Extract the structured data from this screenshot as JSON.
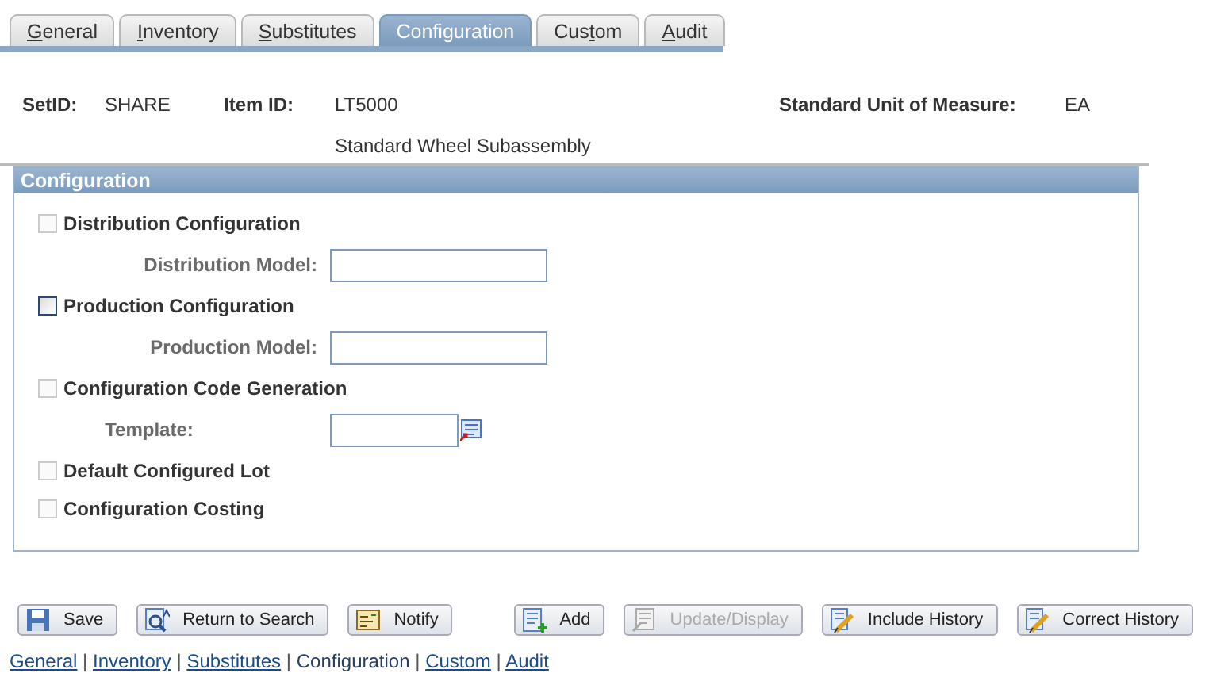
{
  "tabs": [
    {
      "key": "G",
      "post": "eneral",
      "selected": false
    },
    {
      "key": "I",
      "post": "nventory",
      "selected": false
    },
    {
      "key": "S",
      "post": "ubstitutes",
      "selected": false
    },
    {
      "pre": "Configuration",
      "selected": true
    },
    {
      "pre": "Cus",
      "key": "t",
      "post": "om",
      "selected": false
    },
    {
      "key": "A",
      "post": "udit",
      "selected": false
    }
  ],
  "header": {
    "setid_label": "SetID:",
    "setid": "SHARE",
    "item_label": "Item ID:",
    "item_id": "LT5000",
    "item_description": "Standard Wheel Subassembly",
    "uom_label": "Standard Unit of Measure:",
    "uom": "EA"
  },
  "section": {
    "title": "Configuration",
    "rows": [
      {
        "kind": "checkbox",
        "label": "Distribution Configuration",
        "checked": false,
        "disabled": true
      },
      {
        "kind": "field",
        "label": "Distribution Model:",
        "lookup": false
      },
      {
        "kind": "checkbox",
        "label": "Production Configuration",
        "checked": false,
        "disabled": false
      },
      {
        "kind": "field",
        "label": "Production Model:",
        "lookup": false
      },
      {
        "kind": "checkbox",
        "label": "Configuration Code Generation",
        "checked": false,
        "disabled": true
      },
      {
        "kind": "field",
        "label": "Template:",
        "lookup": true
      },
      {
        "kind": "checkbox",
        "label": "Default Configured Lot",
        "checked": false,
        "disabled": true
      },
      {
        "kind": "checkbox",
        "label": "Configuration Costing",
        "checked": false,
        "disabled": true
      }
    ]
  },
  "buttons_left": [
    {
      "kind": "save",
      "label": "Save",
      "disabled": false
    },
    {
      "kind": "return",
      "label": "Return to Search",
      "disabled": false
    },
    {
      "kind": "notify",
      "label": "Notify",
      "disabled": false
    }
  ],
  "buttons_right": [
    {
      "kind": "add",
      "label": "Add",
      "disabled": false
    },
    {
      "kind": "update",
      "label": "Update/Display",
      "disabled": true
    },
    {
      "kind": "include",
      "label": "Include History",
      "disabled": false
    },
    {
      "kind": "correct",
      "label": "Correct History",
      "disabled": false
    }
  ],
  "footer_links": [
    {
      "label": "General",
      "selected": false
    },
    {
      "separator": "|",
      "label": "Inventory",
      "selected": false
    },
    {
      "separator": "|",
      "label": "Substitutes",
      "selected": false
    },
    {
      "separator": "|",
      "label": "Configuration",
      "selected": true
    },
    {
      "separator": "|",
      "label": "Custom",
      "selected": false
    },
    {
      "separator": "|",
      "label": "Audit",
      "selected": false
    }
  ]
}
